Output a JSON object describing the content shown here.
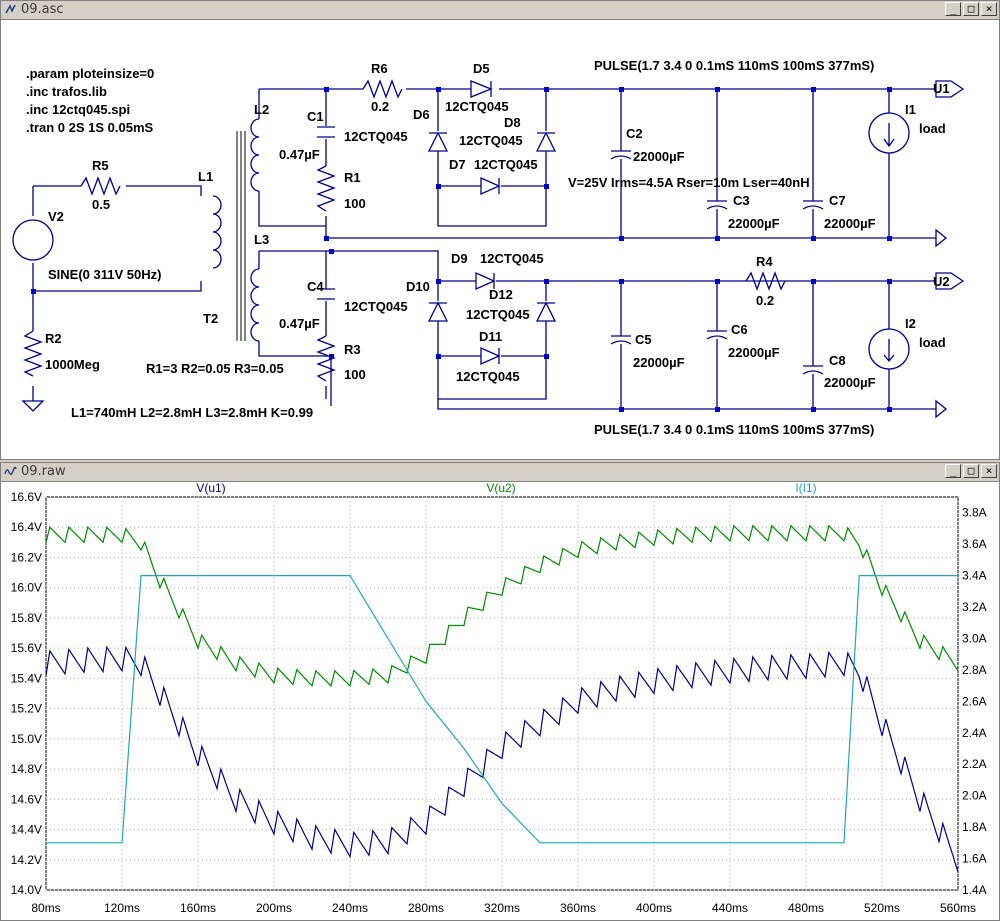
{
  "schematic_window": {
    "title": "09.asc",
    "directives": [
      ".param ploteinsize=0",
      ".inc trafos.lib",
      ".inc 12ctq045.spi",
      ".tran 0 2S 1S 0.05mS"
    ],
    "pulse_top": "PULSE(1.7 3.4 0 0.1mS 110mS 100mS 377mS)",
    "pulse_bottom": "PULSE(1.7 3.4 0 0.1mS 110mS 100mS 377mS)",
    "sine": "SINE(0 311V 50Hz)",
    "transformer_params": "R1=3 R2=0.05 R3=0.05",
    "inductance_params": "L1=740mH L2=2.8mH L3=2.8mH  K=0.99",
    "cap_params": "V=25V Irms=4.5A Rser=10m Lser=40nH",
    "labels": {
      "R5": "R5",
      "R5v": "0.5",
      "V2": "V2",
      "L1": "L1",
      "L2": "L2",
      "L3": "L3",
      "T2": "T2",
      "R2": "R2",
      "R2v": "1000Meg",
      "C1": "C1",
      "C1v": "0.47µF",
      "C1m": "12CTQ045",
      "R1": "R1",
      "R1v": "100",
      "R6": "R6",
      "R6v": "0.2",
      "C4": "C4",
      "C4v": "0.47µF",
      "C4m": "12CTQ045",
      "R3": "R3",
      "R3v": "100",
      "D5": "D5",
      "D5m": "12CTQ045",
      "D6": "D6",
      "D8": "D8",
      "D8m": "12CTQ045",
      "D7": "D7",
      "D7m": "12CTQ045",
      "D9": "D9",
      "D9m": "12CTQ045",
      "D10": "D10",
      "D12": "D12",
      "D12m": "12CTQ045",
      "D11": "D11",
      "D11m": "12CTQ045",
      "C2": "C2",
      "C2v": "22000µF",
      "C3": "C3",
      "C3v": "22000µF",
      "C7": "C7",
      "C7v": "22000µF",
      "C5": "C5",
      "C5v": "22000µF",
      "C6": "C6",
      "C6v": "22000µF",
      "C8": "C8",
      "C8v": "22000µF",
      "R4": "R4",
      "R4v": "0.2",
      "I1": "I1",
      "I1v": "load",
      "I2": "I2",
      "I2v": "load",
      "U1": "U1",
      "U2": "U2"
    }
  },
  "waveform_window": {
    "title": "09.raw",
    "colors": {
      "u1": "#00008b",
      "u2": "#008b00",
      "il1": "#20a8b8",
      "grid": "#b0b0b0"
    }
  },
  "chart_data": {
    "type": "line",
    "x": [
      80,
      100,
      120,
      130,
      140,
      160,
      180,
      200,
      220,
      240,
      260,
      280,
      300,
      320,
      340,
      360,
      380,
      400,
      420,
      440,
      460,
      480,
      500,
      508,
      520,
      540,
      560
    ],
    "xlabel": "",
    "x_ticks": [
      "80ms",
      "120ms",
      "160ms",
      "200ms",
      "240ms",
      "280ms",
      "320ms",
      "360ms",
      "400ms",
      "440ms",
      "480ms",
      "520ms",
      "560ms"
    ],
    "xlim": [
      80,
      560
    ],
    "y_left_ticks": [
      "14.0V",
      "14.2V",
      "14.4V",
      "14.6V",
      "14.8V",
      "15.0V",
      "15.2V",
      "15.4V",
      "15.6V",
      "15.8V",
      "16.0V",
      "16.2V",
      "16.4V",
      "16.6V"
    ],
    "ylim_left": [
      14.0,
      16.6
    ],
    "y_right_ticks": [
      "1.4A",
      "1.6A",
      "1.8A",
      "2.0A",
      "2.2A",
      "2.4A",
      "2.6A",
      "2.8A",
      "3.0A",
      "3.2A",
      "3.4A",
      "3.6A",
      "3.8A"
    ],
    "ylim_right": [
      1.4,
      3.9
    ],
    "grid": true,
    "series": [
      {
        "name": "V(u1)",
        "axis": "left",
        "values": [
          15.5,
          15.52,
          15.53,
          15.5,
          15.3,
          14.9,
          14.6,
          14.45,
          14.35,
          14.3,
          14.32,
          14.45,
          14.7,
          14.95,
          15.1,
          15.25,
          15.33,
          15.38,
          15.42,
          15.45,
          15.47,
          15.48,
          15.5,
          15.45,
          15.1,
          14.6,
          14.2
        ]
      },
      {
        "name": "V(u2)",
        "axis": "left",
        "values": [
          16.35,
          16.35,
          16.35,
          16.3,
          16.05,
          15.65,
          15.5,
          15.42,
          15.4,
          15.4,
          15.42,
          15.55,
          15.8,
          16.0,
          16.15,
          16.25,
          16.3,
          16.33,
          16.35,
          16.36,
          16.36,
          16.36,
          16.36,
          16.3,
          16.0,
          15.65,
          15.5
        ]
      },
      {
        "name": "I(I1)",
        "axis": "right",
        "values": [
          1.7,
          1.7,
          1.7,
          3.4,
          3.4,
          3.4,
          3.4,
          3.4,
          3.4,
          3.4,
          3.0,
          2.6,
          2.3,
          1.95,
          1.7,
          1.7,
          1.7,
          1.7,
          1.7,
          1.7,
          1.7,
          1.7,
          1.7,
          3.4,
          3.4,
          3.4,
          3.4
        ]
      }
    ]
  }
}
